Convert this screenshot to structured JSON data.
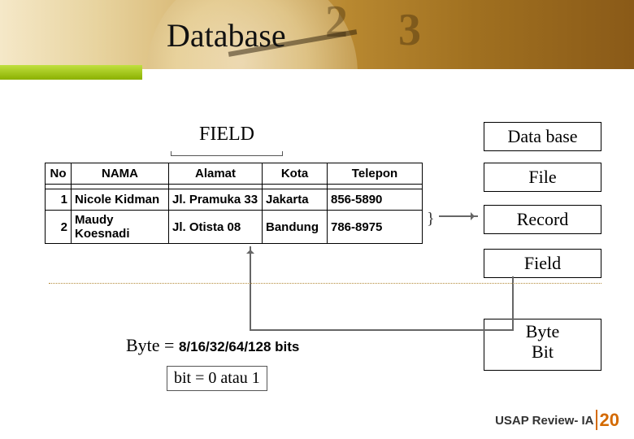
{
  "title": "Database",
  "field_label": "FIELD",
  "table": {
    "headers": [
      "No",
      "NAMA",
      "Alamat",
      "Kota",
      "Telepon"
    ],
    "rows": [
      {
        "no": "1",
        "nama": "Nicole Kidman",
        "alamat": "Jl. Pramuka 33",
        "kota": "Jakarta",
        "telepon": "856-5890"
      },
      {
        "no": "2",
        "nama": "Maudy Koesnadi",
        "alamat": "Jl. Otista 08",
        "kota": "Bandung",
        "telepon": "786-8975"
      }
    ]
  },
  "hierarchy": {
    "database": "Data base",
    "file": "File",
    "record": "Record",
    "field": "Field",
    "byte": "Byte",
    "bit": "Bit"
  },
  "byte_equation_prefix": "Byte = ",
  "byte_equation_value": "8/16/32/64/128 bits",
  "bit_equation": "bit = 0 atau 1",
  "footer_text": "USAP Review- IA",
  "footer_page": "20"
}
